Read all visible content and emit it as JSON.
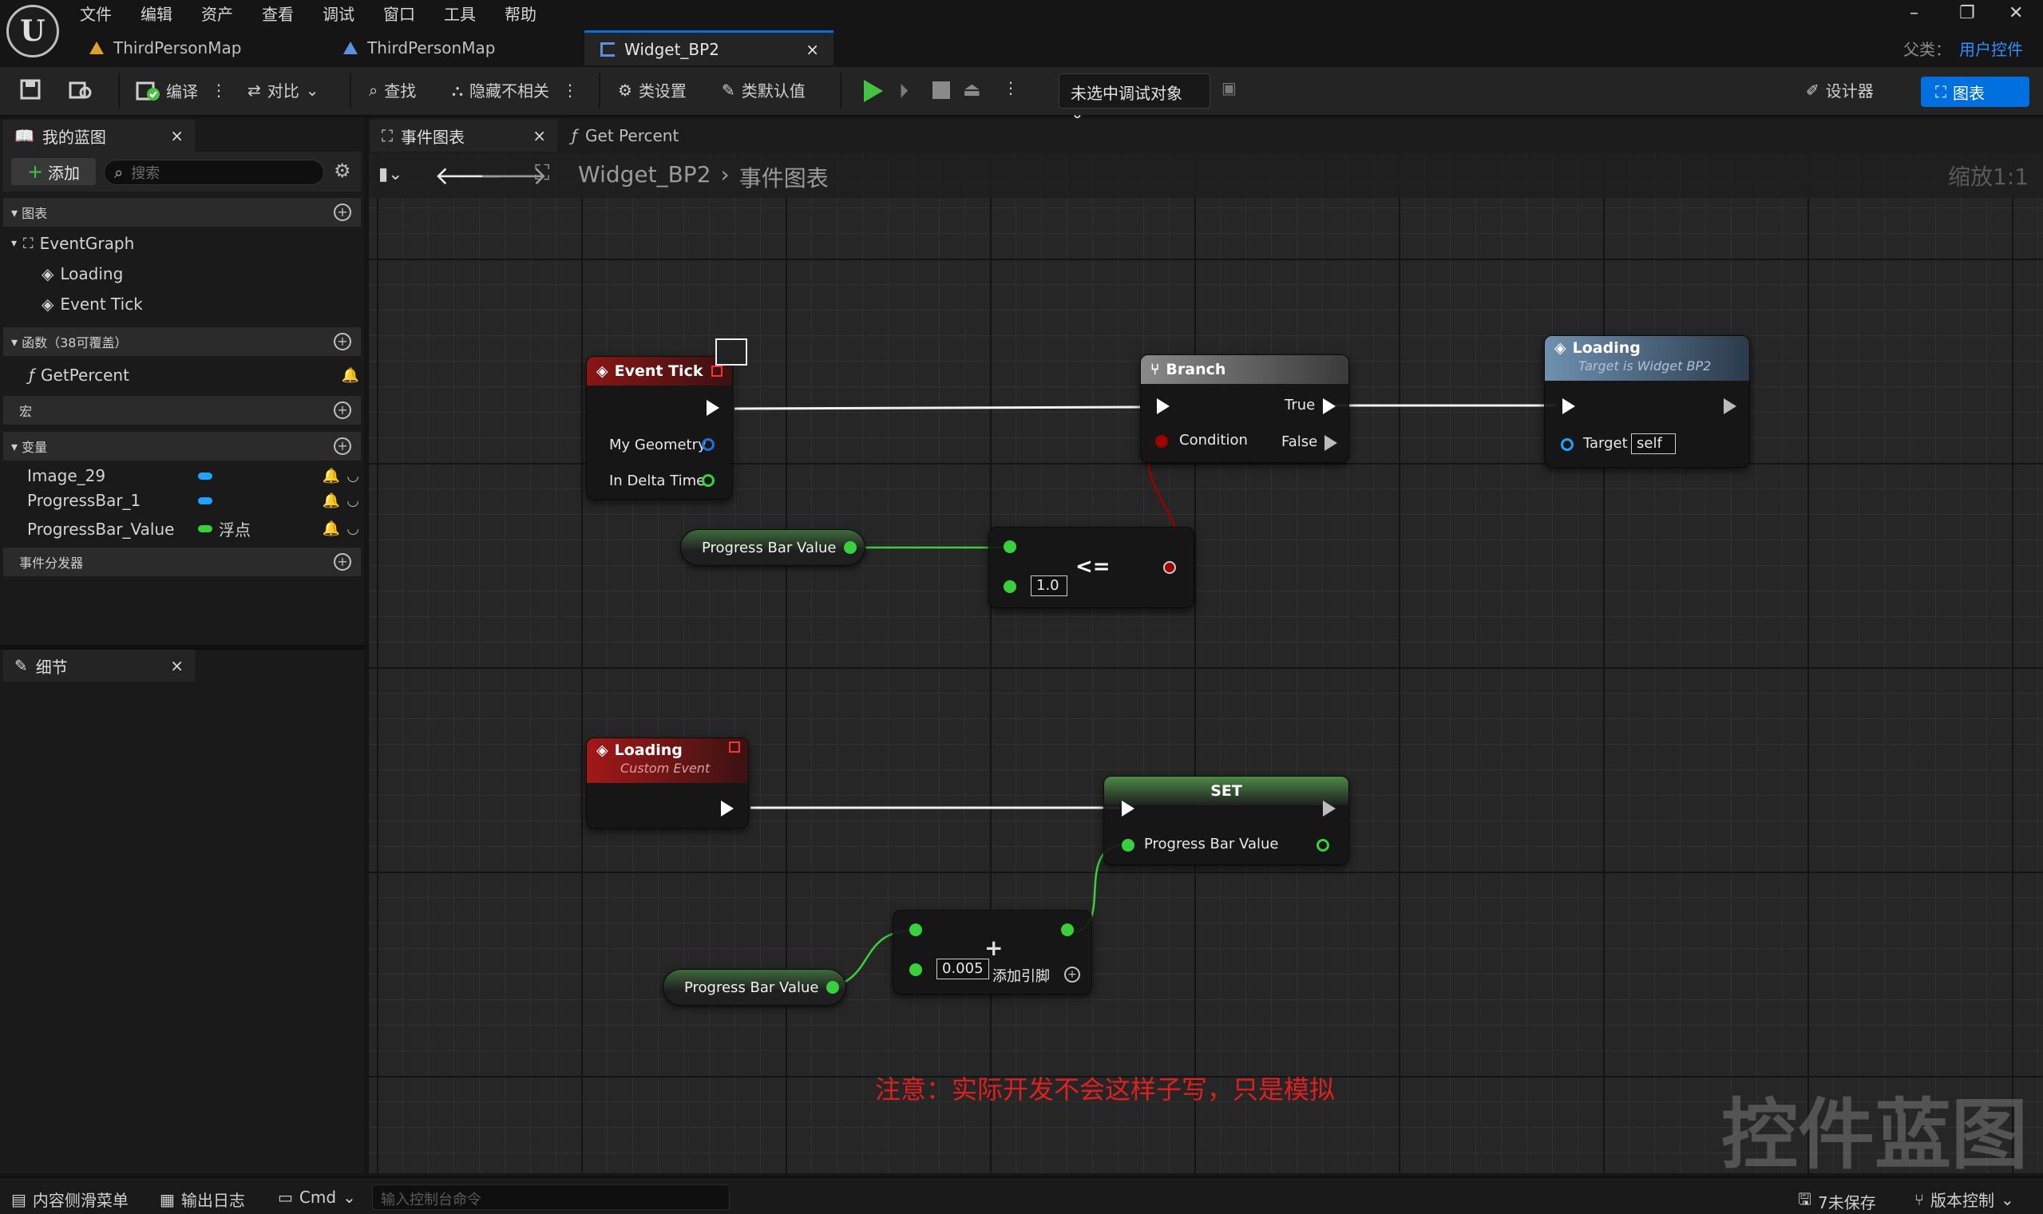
{
  "menu": [
    "文件",
    "编辑",
    "资产",
    "查看",
    "调试",
    "窗口",
    "工具",
    "帮助"
  ],
  "tabs": [
    {
      "label": "ThirdPersonMap"
    },
    {
      "label": "ThirdPersonMap"
    },
    {
      "label": "Widget_BP2",
      "close": "×"
    }
  ],
  "parent_class": {
    "label": "父类：",
    "value": "用户控件"
  },
  "toolbar": {
    "compile": "编译",
    "diff": "对比",
    "find": "查找",
    "hide_unrelated": "隐藏不相关",
    "class_settings": "类设置",
    "class_defaults": "类默认值",
    "debug_target": "未选中调试对象",
    "designer": "设计器",
    "graph": "图表"
  },
  "my_blueprint": {
    "tab": "我的蓝图",
    "close": "×",
    "add": "添加",
    "search_placeholder": "搜索",
    "graphs_header": "图表",
    "event_graph": "EventGraph",
    "events": [
      "Loading",
      "Event Tick"
    ],
    "functions_header": "函数（38可覆盖）",
    "functions": [
      "GetPercent"
    ],
    "macros_header": "宏",
    "variables_header": "变量",
    "variables": [
      {
        "name": "Image_29",
        "type": "",
        "color": "#1fa3ff"
      },
      {
        "name": "ProgressBar_1",
        "type": "",
        "color": "#1fa3ff"
      },
      {
        "name": "ProgressBar_Value",
        "type": "浮点",
        "color": "#38d13b"
      }
    ],
    "dispatchers_header": "事件分发器"
  },
  "details": {
    "tab": "细节",
    "close": "×"
  },
  "graph_tabs": [
    {
      "label": "事件图表",
      "close": "×"
    },
    {
      "label": "Get Percent"
    }
  ],
  "breadcrumb": {
    "root": "Widget_BP2",
    "current": "事件图表"
  },
  "zoom": "缩放1:1",
  "nodes": {
    "event_tick": {
      "title": "Event Tick",
      "pins": [
        "My Geometry",
        "In Delta Time"
      ]
    },
    "branch": {
      "title": "Branch",
      "condition": "Condition",
      "true": "True",
      "false": "False"
    },
    "loading_call": {
      "title": "Loading",
      "subtitle": "Target is Widget BP2",
      "target": "Target",
      "target_value": "self"
    },
    "get_var_1": {
      "label": "Progress Bar Value"
    },
    "compare": {
      "op": "<=",
      "value": "1.0"
    },
    "loading_event": {
      "title": "Loading",
      "subtitle": "Custom Event"
    },
    "set": {
      "title": "SET",
      "pin": "Progress Bar Value"
    },
    "add": {
      "op": "+",
      "value": "0.005",
      "add_pin": "添加引脚"
    },
    "get_var_2": {
      "label": "Progress Bar Value"
    }
  },
  "note": "注意：实际开发不会这样子写，只是模拟",
  "watermark": "控件蓝图",
  "statusbar": {
    "content_drawer": "内容侧滑菜单",
    "output_log": "输出日志",
    "cmd": "Cmd",
    "console_placeholder": "输入控制台命令",
    "unsaved": "7未保存",
    "source_control": "版本控制"
  },
  "colors": {
    "accent": "#0070e0",
    "exec": "#ffffff",
    "float": "#38d13b",
    "bool": "#9e0000",
    "object": "#1fa3ff",
    "event_header": "#8a1515",
    "note": "#e02020"
  }
}
